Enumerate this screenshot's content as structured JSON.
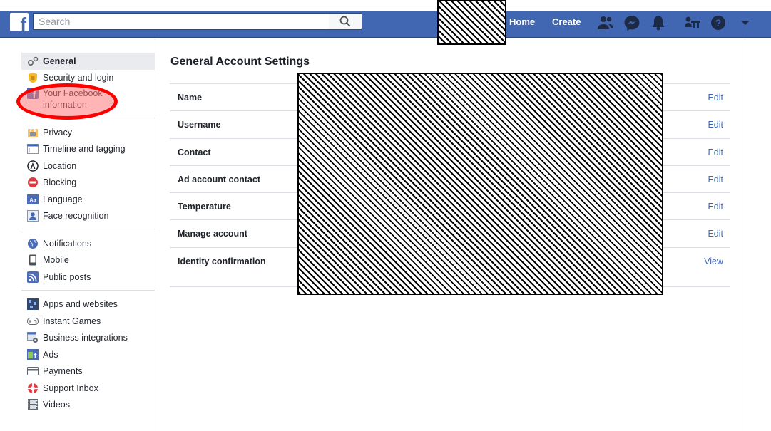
{
  "topbar": {
    "logo_letter": "f",
    "search_placeholder": "Search",
    "home_label": "Home",
    "create_label": "Create",
    "icons": [
      "friends-icon",
      "messenger-icon",
      "notifications-icon",
      "quick-help-icon",
      "help-icon",
      "account-menu-icon"
    ]
  },
  "sidebar": {
    "group1": [
      {
        "label": "General",
        "icon": "gear-icon",
        "active": true
      },
      {
        "label": "Security and login",
        "icon": "shield-icon"
      },
      {
        "label": "Your Facebook information",
        "icon": "facebook-icon"
      }
    ],
    "group2": [
      {
        "label": "Privacy",
        "icon": "lock-icon"
      },
      {
        "label": "Timeline and tagging",
        "icon": "timeline-icon"
      },
      {
        "label": "Location",
        "icon": "location-icon"
      },
      {
        "label": "Blocking",
        "icon": "blocking-icon"
      },
      {
        "label": "Language",
        "icon": "language-icon"
      },
      {
        "label": "Face recognition",
        "icon": "face-recognition-icon"
      }
    ],
    "group3": [
      {
        "label": "Notifications",
        "icon": "globe-icon"
      },
      {
        "label": "Mobile",
        "icon": "mobile-icon"
      },
      {
        "label": "Public posts",
        "icon": "rss-icon"
      }
    ],
    "group4": [
      {
        "label": "Apps and websites",
        "icon": "apps-icon"
      },
      {
        "label": "Instant Games",
        "icon": "gamepad-icon"
      },
      {
        "label": "Business integrations",
        "icon": "business-icon"
      },
      {
        "label": "Ads",
        "icon": "ads-icon"
      },
      {
        "label": "Payments",
        "icon": "card-icon"
      },
      {
        "label": "Support Inbox",
        "icon": "lifebuoy-icon"
      },
      {
        "label": "Videos",
        "icon": "film-icon"
      }
    ]
  },
  "main": {
    "title": "General Account Settings",
    "rows": [
      {
        "label": "Name",
        "action": "Edit"
      },
      {
        "label": "Username",
        "action": "Edit"
      },
      {
        "label": "Contact",
        "action": "Edit"
      },
      {
        "label": "Ad account contact",
        "action": "Edit"
      },
      {
        "label": "Temperature",
        "action": "Edit"
      },
      {
        "label": "Manage account",
        "action": "Edit"
      },
      {
        "label": "Identity confirmation",
        "action": "View"
      }
    ]
  },
  "colors": {
    "brand": "#4267b2",
    "highlight": "#ff0000"
  }
}
